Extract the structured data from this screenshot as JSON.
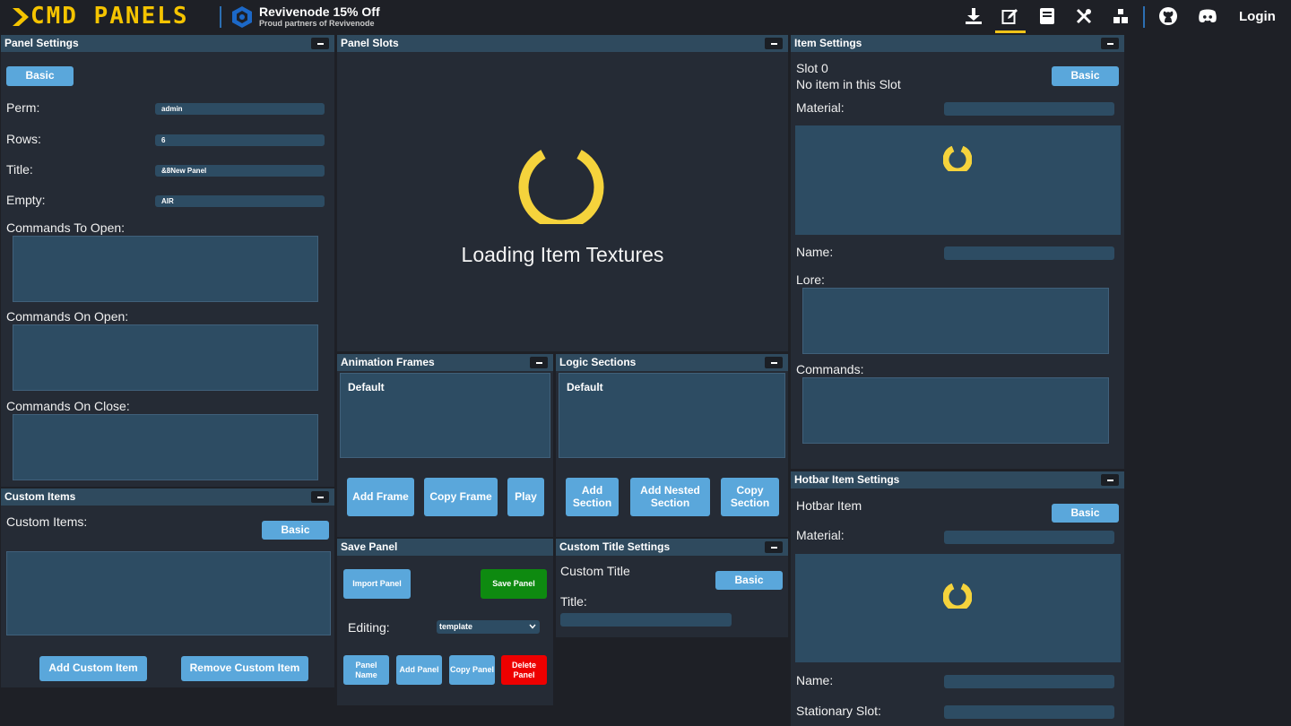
{
  "header": {
    "logo_text": "CMD PANELS",
    "promo_title": "Revivenode 15% Off",
    "promo_subtitle": "Proud partners of Revivenode",
    "login_label": "Login",
    "nav_icons": [
      "download-icon",
      "edit-icon",
      "book-icon",
      "tools-icon",
      "blocks-icon",
      "github-icon",
      "discord-icon"
    ],
    "accent_color": "#f0c419"
  },
  "panel_settings": {
    "title": "Panel Settings",
    "mode_button": "Basic",
    "perm_label": "Perm:",
    "perm_value": "admin",
    "rows_label": "Rows:",
    "rows_value": "6",
    "title_label": "Title:",
    "title_value": "&8New Panel",
    "empty_label": "Empty:",
    "empty_value": "AIR",
    "commands_to_open_label": "Commands To Open:",
    "commands_on_open_label": "Commands On Open:",
    "commands_on_close_label": "Commands On Close:"
  },
  "custom_items": {
    "title": "Custom Items",
    "label": "Custom Items:",
    "mode_button": "Basic",
    "add_button": "Add Custom Item",
    "remove_button": "Remove Custom Item"
  },
  "panel_slots": {
    "title": "Panel Slots",
    "loading_text": "Loading Item Textures"
  },
  "animation_frames": {
    "title": "Animation Frames",
    "default_entry": "Default",
    "add_button": "Add Frame",
    "copy_button": "Copy Frame",
    "play_button": "Play"
  },
  "logic_sections": {
    "title": "Logic Sections",
    "default_entry": "Default",
    "add_button": "Add Section",
    "add_nested_button": "Add Nested Section",
    "copy_button": "Copy Section"
  },
  "save_panel": {
    "title": "Save Panel",
    "import_button": "Import Panel",
    "save_button": "Save Panel",
    "editing_label": "Editing:",
    "editing_value": "template",
    "panel_name_button": "Panel Name",
    "add_panel_button": "Add Panel",
    "copy_panel_button": "Copy Panel",
    "delete_panel_button": "Delete Panel"
  },
  "custom_title_settings": {
    "title": "Custom Title Settings",
    "label": "Custom Title",
    "mode_button": "Basic",
    "title_label": "Title:"
  },
  "item_settings": {
    "title": "Item Settings",
    "slot_label": "Slot 0",
    "slot_status": "No item in this Slot",
    "mode_button": "Basic",
    "material_label": "Material:",
    "name_label": "Name:",
    "lore_label": "Lore:",
    "commands_label": "Commands:"
  },
  "hotbar_item_settings": {
    "title": "Hotbar Item Settings",
    "label": "Hotbar Item",
    "mode_button": "Basic",
    "material_label": "Material:",
    "name_label": "Name:",
    "stationary_slot_label": "Stationary Slot:"
  }
}
